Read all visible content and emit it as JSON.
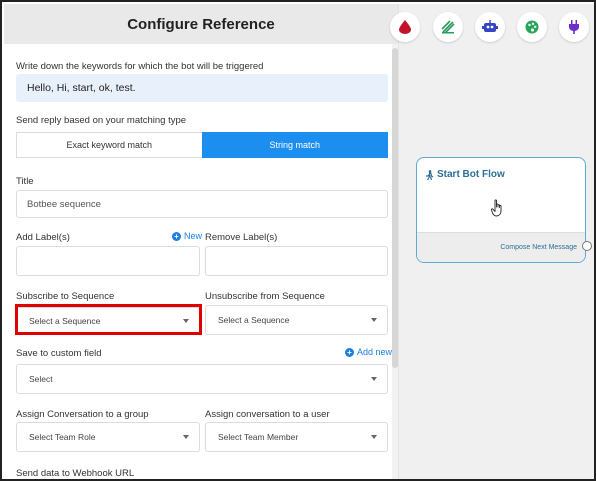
{
  "panel": {
    "title": "Configure Reference",
    "keywords_label": "Write down the keywords for which the bot will be triggered",
    "keywords_value": "Hello, Hi, start, ok, test.",
    "reply_label": "Send reply based on your matching type",
    "match_exact": "Exact keyword match",
    "match_string": "String match",
    "title_label": "Title",
    "title_value": "Botbee sequence",
    "add_label": "Add Label(s)",
    "new_link": "New",
    "remove_label": "Remove Label(s)",
    "subscribe_label": "Subscribe to Sequence",
    "subscribe_select": "Select a Sequence",
    "unsubscribe_label": "Unsubscribe from Sequence",
    "unsubscribe_select": "Select a Sequence",
    "custom_field_label": "Save to custom field",
    "add_new_link": "Add new",
    "custom_field_select": "Select",
    "group_label": "Assign Conversation to a group",
    "group_select": "Select Team Role",
    "user_label": "Assign conversation to a user",
    "user_select": "Select Team Member",
    "webhook_label": "Send data to Webhook URL"
  },
  "canvas": {
    "tools": [
      "blood-drop-icon",
      "stack-icon",
      "robot-icon",
      "palette-icon",
      "plug-icon"
    ],
    "node_title": "Start Bot Flow",
    "node_footer": "Compose Next Message"
  },
  "colors": {
    "accent": "#1c8ef0",
    "highlight": "#e00000",
    "node_border": "#5fa8d6"
  }
}
